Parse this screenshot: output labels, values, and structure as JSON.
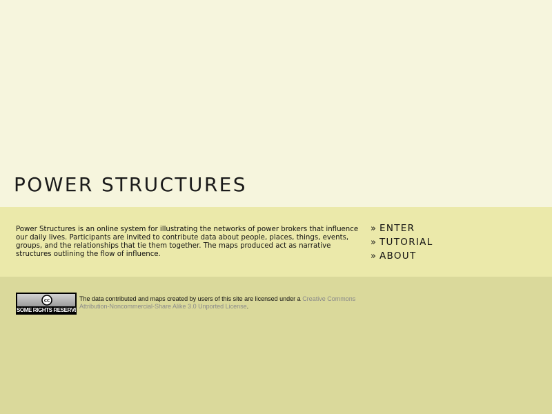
{
  "header": {
    "site_title": "POWER STRUCTURES"
  },
  "intro": {
    "description": "Power Structures is an online system for illustrating the networks of power brokers that influence our daily lives. Participants are invited to contribute data about people, places, things, events, groups, and the relationships that tie them together. The maps produced act as narrative structures outlining the flow of influence."
  },
  "nav": {
    "bullet": "»",
    "items": [
      {
        "label": "ENTER"
      },
      {
        "label": "TUTORIAL"
      },
      {
        "label": "ABOUT"
      }
    ]
  },
  "footer": {
    "badge": {
      "icon": "creative-commons-icon",
      "cc_text": "cc",
      "rights_text": "SOME RIGHTS RESERVED"
    },
    "license_prefix": "The data contributed and maps created by users of this site are licensed under a ",
    "license_link": "Creative Commons Attribution-Noncommercial-Share Alike 3.0 Unported License",
    "license_suffix": "."
  },
  "colors": {
    "top_background": "#f6f5dd",
    "middle_background": "#ebe9aa",
    "bottom_background": "#dad99b",
    "link_gray": "#8a8a8a"
  }
}
